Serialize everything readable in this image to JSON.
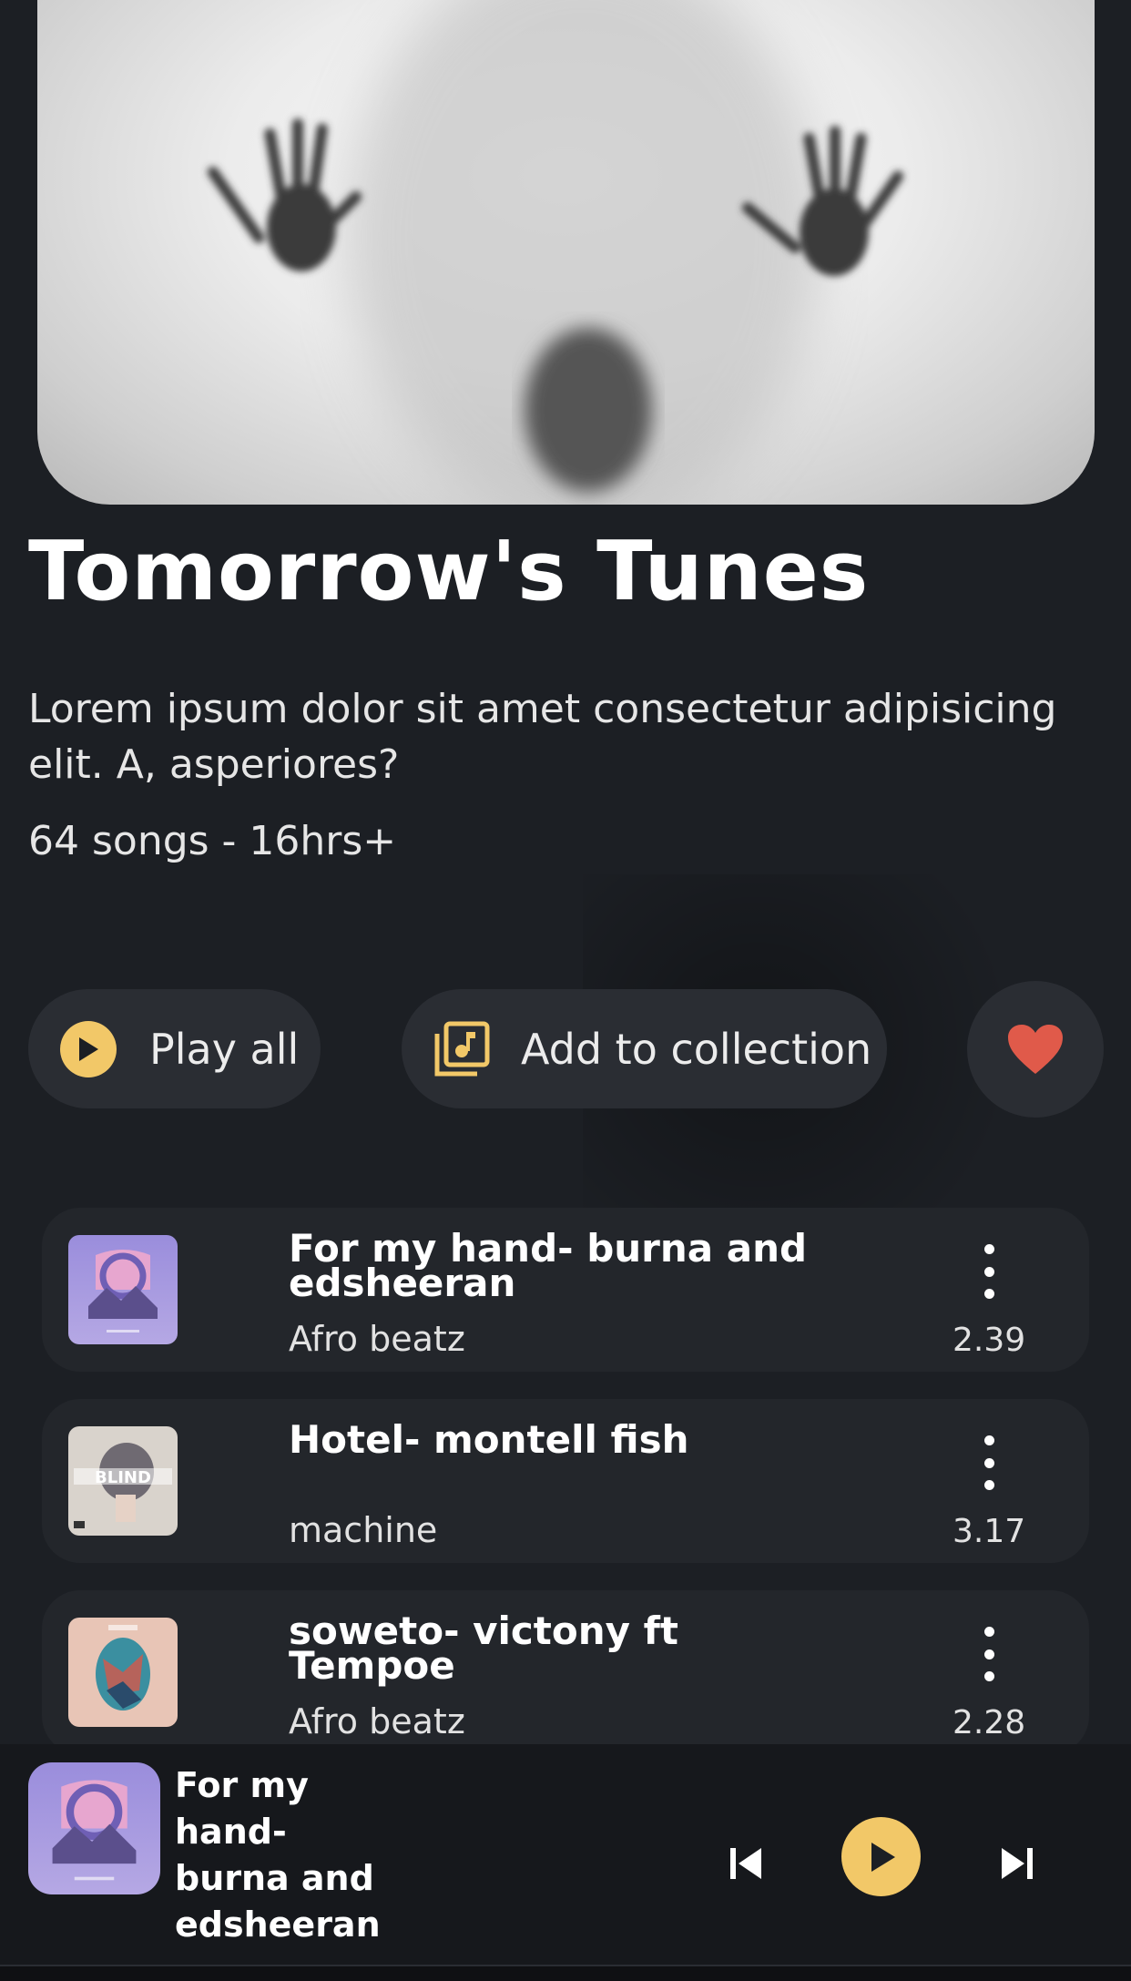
{
  "playlist": {
    "title": "Tomorrow's Tunes",
    "description": "Lorem ipsum dolor sit amet consectetur adipisicing elit. A, asperiores?",
    "meta": "64 songs - 16hrs+"
  },
  "actions": {
    "play_all_label": "Play all",
    "add_collection_label": "Add to collection",
    "favorite_icon": "heart-icon",
    "accent_color": "#f2c868",
    "heart_color": "#e05a4a"
  },
  "tracks": [
    {
      "title": "For my hand- burna and edsheeran",
      "subtitle": "Afro beatz",
      "duration": "2.39"
    },
    {
      "title": "Hotel- montell fish",
      "subtitle": "machine",
      "duration": "3.17"
    },
    {
      "title": "soweto- victony ft Tempoe",
      "subtitle": "Afro beatz",
      "duration": "2.28"
    }
  ],
  "now_playing": {
    "title": "For my hand- burna and edsheeran"
  }
}
